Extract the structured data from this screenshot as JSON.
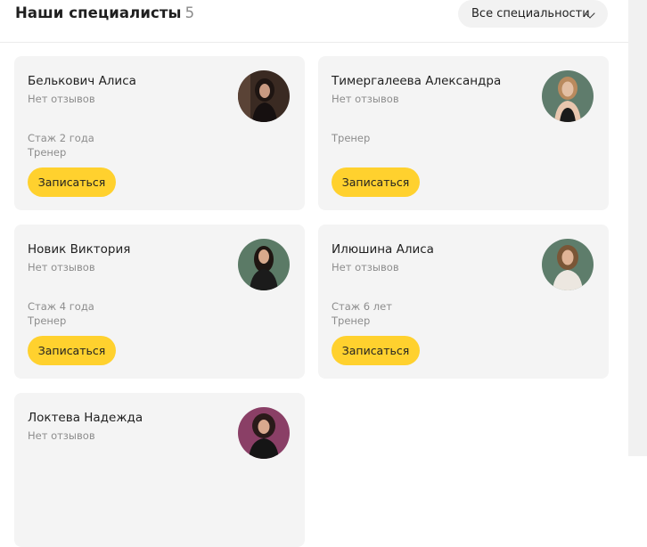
{
  "header": {
    "title": "Наши специалисты",
    "count": "5"
  },
  "filter": {
    "label": "Все специальности",
    "icon": "chevron-down-icon"
  },
  "specialists": [
    {
      "name": "Белькович Алиса",
      "reviews": "Нет отзывов",
      "experience": "Стаж 2 года",
      "role": "Тренер",
      "button": "Записаться",
      "avatar_bg": "#3a2a22"
    },
    {
      "name": "Тимергалеева Александра",
      "reviews": "Нет отзывов",
      "role": "Тренер",
      "button": "Записаться",
      "avatar_bg": "#5f7c6c"
    },
    {
      "name": "Новик Виктория",
      "reviews": "Нет отзывов",
      "experience": "Стаж 4 года",
      "role": "Тренер",
      "button": "Записаться",
      "avatar_bg": "#5b7a66"
    },
    {
      "name": "Илюшина Алиса",
      "reviews": "Нет отзывов",
      "experience": "Стаж 6 лет",
      "role": "Тренер",
      "button": "Записаться",
      "avatar_bg": "#5e7d6b"
    },
    {
      "name": "Локтева Надежда",
      "reviews": "Нет отзывов",
      "avatar_bg": "#8a3f66"
    }
  ],
  "colors": {
    "accent": "#ffd12e",
    "card": "#f4f4f4",
    "muted": "#8d8d8d"
  }
}
